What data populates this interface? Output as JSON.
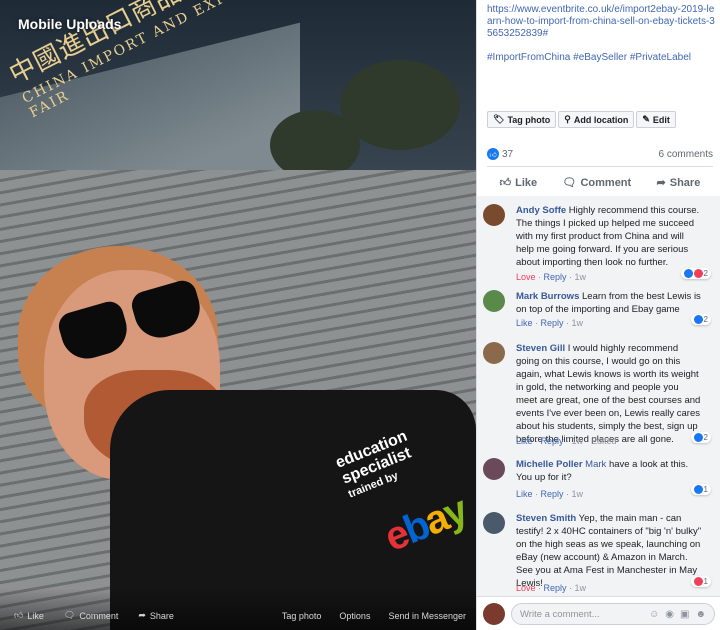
{
  "album_title": "Mobile Uploads",
  "photo": {
    "sign_cn": "中國進出口商品交易會",
    "sign_en": "CHINA IMPORT AND EXPORT FAIR",
    "shirt_text": [
      "education",
      "specialist",
      "trained by"
    ],
    "shirt_logo": [
      "e",
      "b",
      "a",
      "y"
    ]
  },
  "photo_bar": {
    "like": "Like",
    "comment": "Comment",
    "share": "Share",
    "tag_photo": "Tag photo",
    "options": "Options",
    "send": "Send in Messenger"
  },
  "post": {
    "link": "https://www.eventbrite.co.uk/e/import2ebay-2019-learn-how-to-import-from-china-sell-on-ebay-tickets-35653252839#",
    "hashtags": "#ImportFromChina #eBaySeller #PrivateLabel",
    "actions": {
      "tag": "Tag photo",
      "location": "Add location",
      "edit": "Edit"
    },
    "like_count": "37",
    "comment_count": "6 comments",
    "bar": {
      "like": "Like",
      "comment": "Comment",
      "share": "Share"
    }
  },
  "comments": [
    {
      "name": "Andy Soffe",
      "text": "Highly recommend this course. The things I picked up helped me succeed with my first product from China and will help me going forward. If you are serious about importing then look no further.",
      "reaction_label": "Love",
      "reply": "Reply",
      "time": "1w",
      "reaction_count": "2",
      "avatar_color": "#7a4a2e"
    },
    {
      "name": "Mark Burrows",
      "text": "Learn from the best Lewis is on top of the importing and Ebay game",
      "reaction_label": "Like",
      "reply": "Reply",
      "time": "1w",
      "reaction_count": "2",
      "avatar_color": "#5a8a4a"
    },
    {
      "name": "Steven Gill",
      "text": "I would highly recommend going on this course, I would go on this again, what Lewis knows is worth its weight in gold, the networking and people you meet are great, one of the best courses and events I've ever been on, Lewis really cares about his students, simply the best, sign up before the limited places are all gone.",
      "reaction_label": "Like",
      "reply": "Reply",
      "time": "1w",
      "edited": "Edited",
      "reaction_count": "2",
      "avatar_color": "#8a6a4a"
    },
    {
      "name": "Michelle Poller",
      "mention": "Mark",
      "text": "have a look at this. You up for it?",
      "reaction_label": "Like",
      "reply": "Reply",
      "time": "1w",
      "reaction_count": "1",
      "avatar_color": "#6a4a5a"
    },
    {
      "name": "Steven Smith",
      "text": "Yep, the main man - can testify! 2 x 40HC containers of \"big 'n' bulky\" on the high seas as we speak, launching on eBay (new account) & Amazon in March. See you at Ama Fest in Manchester in May Lewis!",
      "reaction_label": "Love",
      "reply": "Reply",
      "time": "1w",
      "reaction_count": "1",
      "avatar_color": "#4a5a6a"
    }
  ],
  "write_placeholder": "Write a comment...",
  "colors": {
    "fb_blue": "#4267b2",
    "love": "#f33e58",
    "like_badge": "#1877f2"
  }
}
